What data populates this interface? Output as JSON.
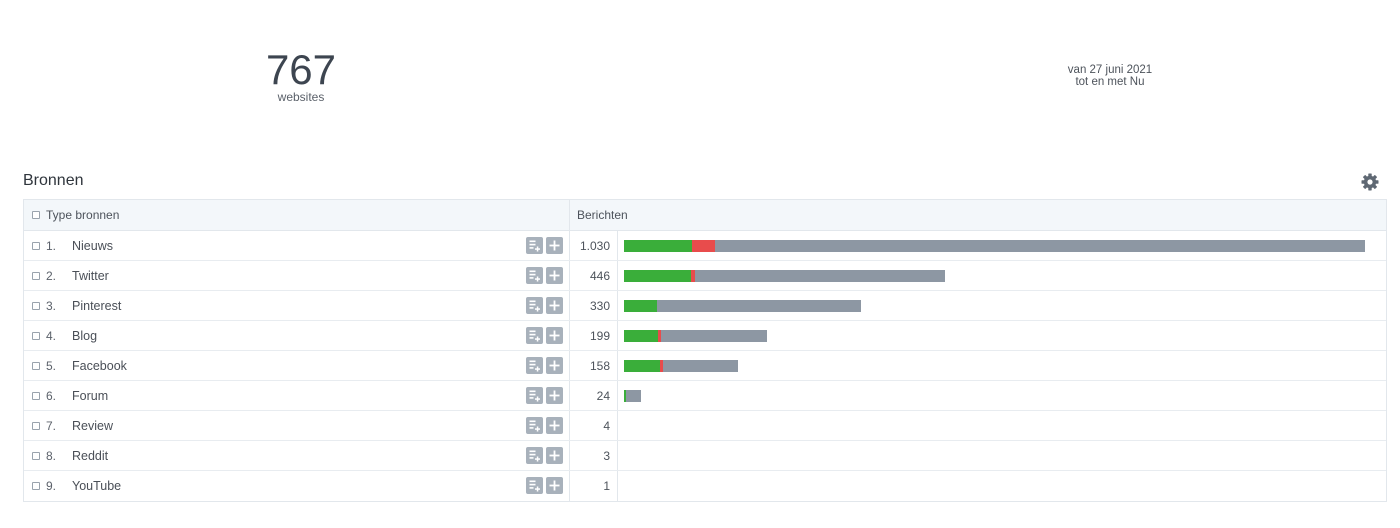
{
  "stats": {
    "value": "767",
    "label": "websites"
  },
  "period": {
    "line1": "van 27 juni 2021",
    "line2": "tot en met Nu"
  },
  "section": {
    "title": "Bronnen"
  },
  "icons": {
    "settings": "gear-icon",
    "report": "report-add-icon",
    "add": "plus-icon"
  },
  "colors": {
    "positive": "#3aae3a",
    "negative": "#e84c4c",
    "neutral": "#8d97a3"
  },
  "table": {
    "col_type": "Type bronnen",
    "col_messages": "Berichten",
    "max_value": 1030,
    "rows": [
      {
        "rank": "1.",
        "name": "Nieuws",
        "count": "1.030",
        "value": 1030,
        "positive": 0.092,
        "negative": 0.031
      },
      {
        "rank": "2.",
        "name": "Twitter",
        "count": "446",
        "value": 446,
        "positive": 0.21,
        "negative": 0.012
      },
      {
        "rank": "3.",
        "name": "Pinterest",
        "count": "330",
        "value": 330,
        "positive": 0.14,
        "negative": 0.0
      },
      {
        "rank": "4.",
        "name": "Blog",
        "count": "199",
        "value": 199,
        "positive": 0.24,
        "negative": 0.02
      },
      {
        "rank": "5.",
        "name": "Facebook",
        "count": "158",
        "value": 158,
        "positive": 0.32,
        "negative": 0.025
      },
      {
        "rank": "6.",
        "name": "Forum",
        "count": "24",
        "value": 24,
        "positive": 0.1,
        "negative": 0.0
      },
      {
        "rank": "7.",
        "name": "Review",
        "count": "4",
        "value": 4,
        "positive": 0.0,
        "negative": 0.0
      },
      {
        "rank": "8.",
        "name": "Reddit",
        "count": "3",
        "value": 3,
        "positive": 0.0,
        "negative": 0.0
      },
      {
        "rank": "9.",
        "name": "YouTube",
        "count": "1",
        "value": 1,
        "positive": 0.0,
        "negative": 0.0
      }
    ]
  }
}
